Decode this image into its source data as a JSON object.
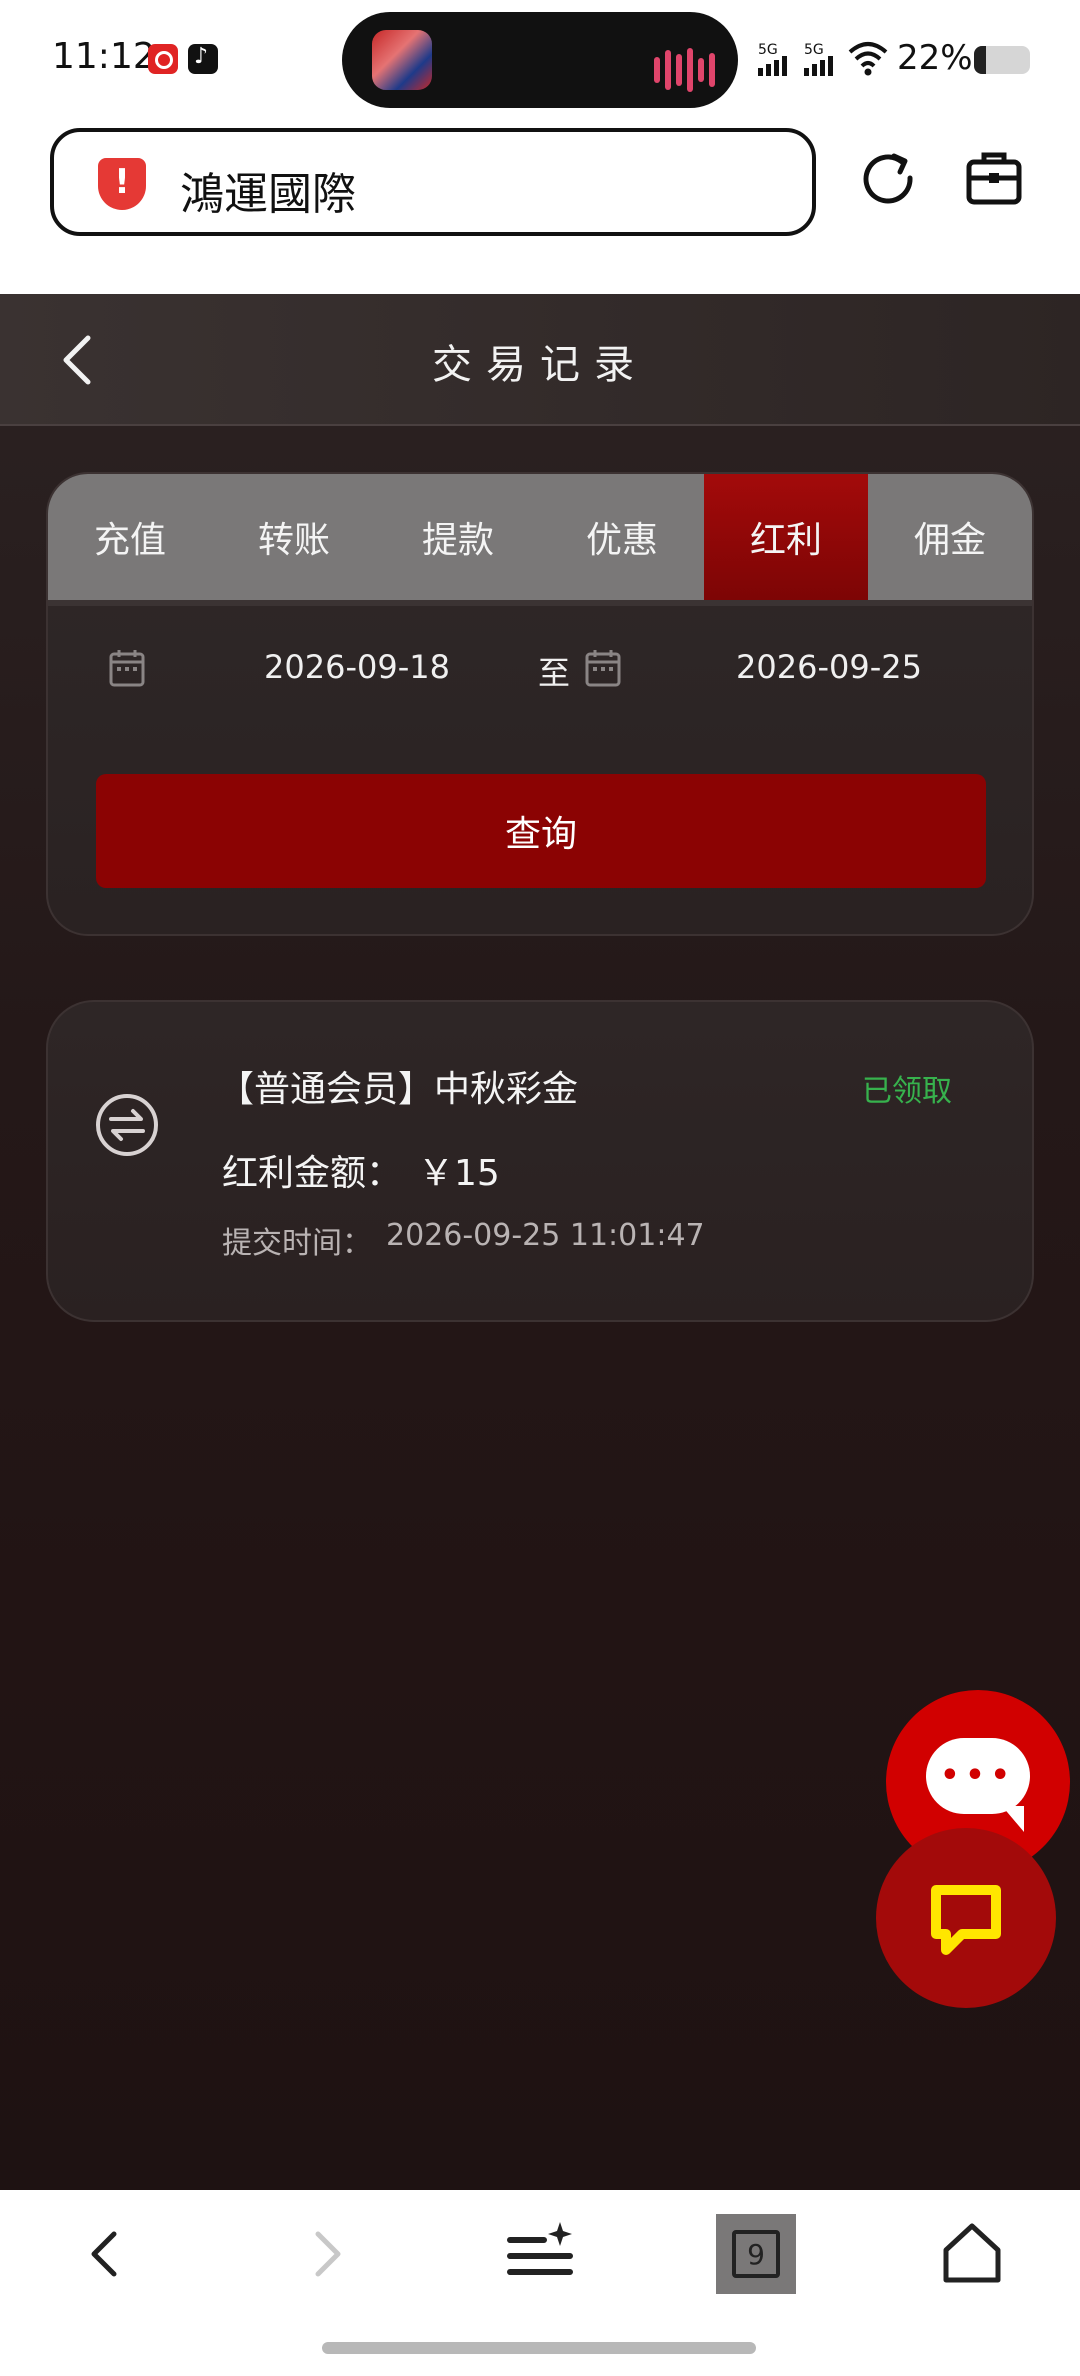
{
  "status_bar": {
    "time": "11:12",
    "network_1": "5G",
    "network_2": "5G",
    "battery_percent": "22%",
    "battery_level": 0.22
  },
  "browser": {
    "url_text": "鴻運國際"
  },
  "header": {
    "title": "交易记录"
  },
  "tabs": [
    {
      "label": "充值",
      "active": false
    },
    {
      "label": "转账",
      "active": false
    },
    {
      "label": "提款",
      "active": false
    },
    {
      "label": "优惠",
      "active": false
    },
    {
      "label": "红利",
      "active": true
    },
    {
      "label": "佣金",
      "active": false
    }
  ],
  "filter": {
    "start_date": "2026-09-18",
    "to_label": "至",
    "end_date": "2026-09-25",
    "query_label": "查询"
  },
  "record": {
    "title": "【普通会员】中秋彩金",
    "status": "已领取",
    "amount_label": "红利金额：",
    "amount": "￥15",
    "time_label": "提交时间：",
    "time": "2026-09-25 11:01:47"
  },
  "bottom_nav": {
    "tab_count": "9"
  },
  "colors": {
    "accent_red": "#8b0303",
    "active_tab": "#a30a0a",
    "status_green": "#37b24d",
    "chat_button": "#d10000",
    "live_icon": "#ffe600"
  }
}
